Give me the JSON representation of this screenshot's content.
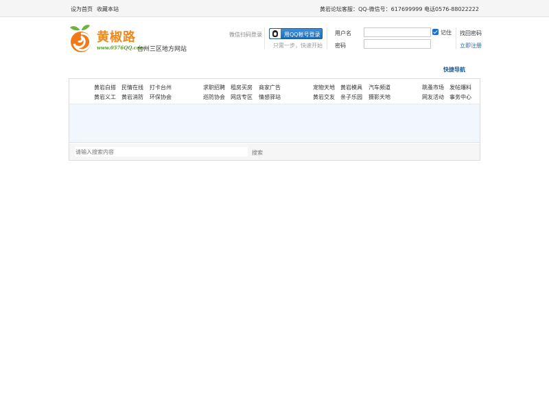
{
  "topbar": {
    "set_home": "设为首页",
    "bookmark": "收藏本站",
    "service": "黄岩论坛客服：QQ-微信号：617699999 电话0576-88022222"
  },
  "logo": {
    "brand": "黄椒路",
    "url": "www.0576QQ.com",
    "slogan": "台州三区地方网站"
  },
  "login": {
    "wechat": "微信扫码登录",
    "qq_button": "用QQ帐号登录",
    "tip": "只需一步，快速开始",
    "username_label": "用户名",
    "password_label": "密码",
    "remember": "记住",
    "forgot": "找回密码",
    "register": "立即注册"
  },
  "quicknav": "快捷导航",
  "nav": {
    "row1": [
      "黄岩白搭",
      "民情在线",
      "打卡台州",
      "求职招聘",
      "租房买房",
      "商家广告",
      "宠物天地",
      "黄岩模具",
      "汽车频道",
      "跳蚤市场",
      "发帖爆料"
    ],
    "row2": [
      "黄岩义工",
      "黄岩消防",
      "环保协会",
      "巡防协会",
      "网店专区",
      "情感驿站",
      "黄岩交友",
      "亲子乐园",
      "摄影天地",
      "网友活动",
      "事务中心"
    ]
  },
  "search": {
    "placeholder": "请输入搜索内容",
    "button": "搜索"
  },
  "colors": {
    "brand_orange": "#f08a1c",
    "link_blue": "#2b6aa8",
    "qq_blue": "#2a7cc7",
    "panel_blue": "#f1f7fd"
  }
}
